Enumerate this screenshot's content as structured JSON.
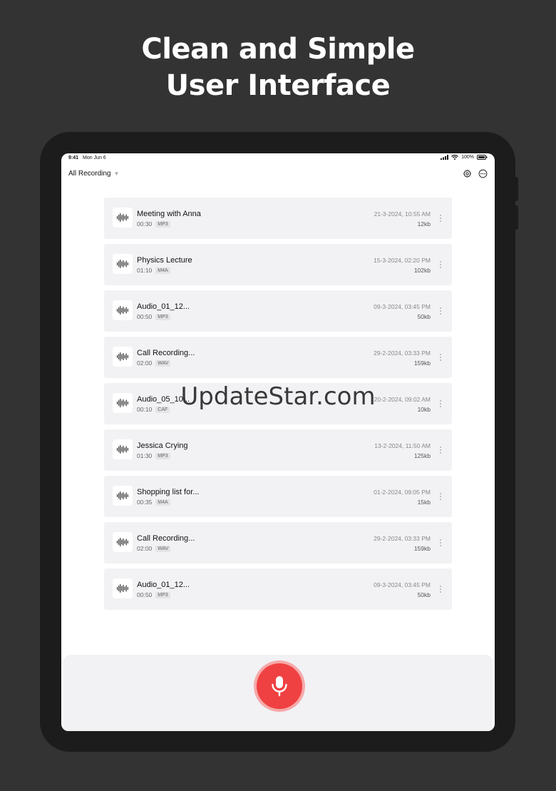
{
  "headline": {
    "line1": "Clean and Simple",
    "line2": "User Interface"
  },
  "status_bar": {
    "time": "9:41",
    "date": "Mon Jun 6",
    "battery": "100%"
  },
  "toolbar": {
    "filter_label": "All Recording",
    "filter_caret": "▼",
    "settings_icon": "gear-icon",
    "more_icon": "more-horizontal-icon"
  },
  "recordings": [
    {
      "title": "Meeting with Anna",
      "duration": "00:30",
      "format": "MP3",
      "date": "21-3-2024, 10:55 AM",
      "size": "12kb"
    },
    {
      "title": "Physics Lecture",
      "duration": "01:10",
      "format": "M4A",
      "date": "15-3-2024, 02:20 PM",
      "size": "102kb"
    },
    {
      "title": "Audio_01_12...",
      "duration": "00:50",
      "format": "MP3",
      "date": "09-3-2024, 03:45 PM",
      "size": "50kb"
    },
    {
      "title": "Call Recording...",
      "duration": "02:00",
      "format": "WAV",
      "date": "29-2-2024, 03:33 PM",
      "size": "159kb"
    },
    {
      "title": "Audio_05_10...",
      "duration": "00:10",
      "format": "CAF",
      "date": "20-2-2024, 09:02 AM",
      "size": "10kb"
    },
    {
      "title": "Jessica Crying",
      "duration": "01:30",
      "format": "MP3",
      "date": "13-2-2024, 11:50 AM",
      "size": "125kb"
    },
    {
      "title": "Shopping list for...",
      "duration": "00:35",
      "format": "M4A",
      "date": "01-2-2024, 09:05 PM",
      "size": "15kb"
    },
    {
      "title": "Call Recording...",
      "duration": "02:00",
      "format": "WAV",
      "date": "29-2-2024, 03:33 PM",
      "size": "159kb"
    },
    {
      "title": "Audio_01_12...",
      "duration": "00:50",
      "format": "MP3",
      "date": "09-3-2024, 03:45 PM",
      "size": "50kb"
    }
  ],
  "record_button": {
    "icon": "microphone-icon",
    "color": "#ef4142"
  },
  "watermark": "UpdateStar.com",
  "colors": {
    "background": "#333333",
    "card": "#f2f2f5",
    "accent": "#ef4142"
  }
}
